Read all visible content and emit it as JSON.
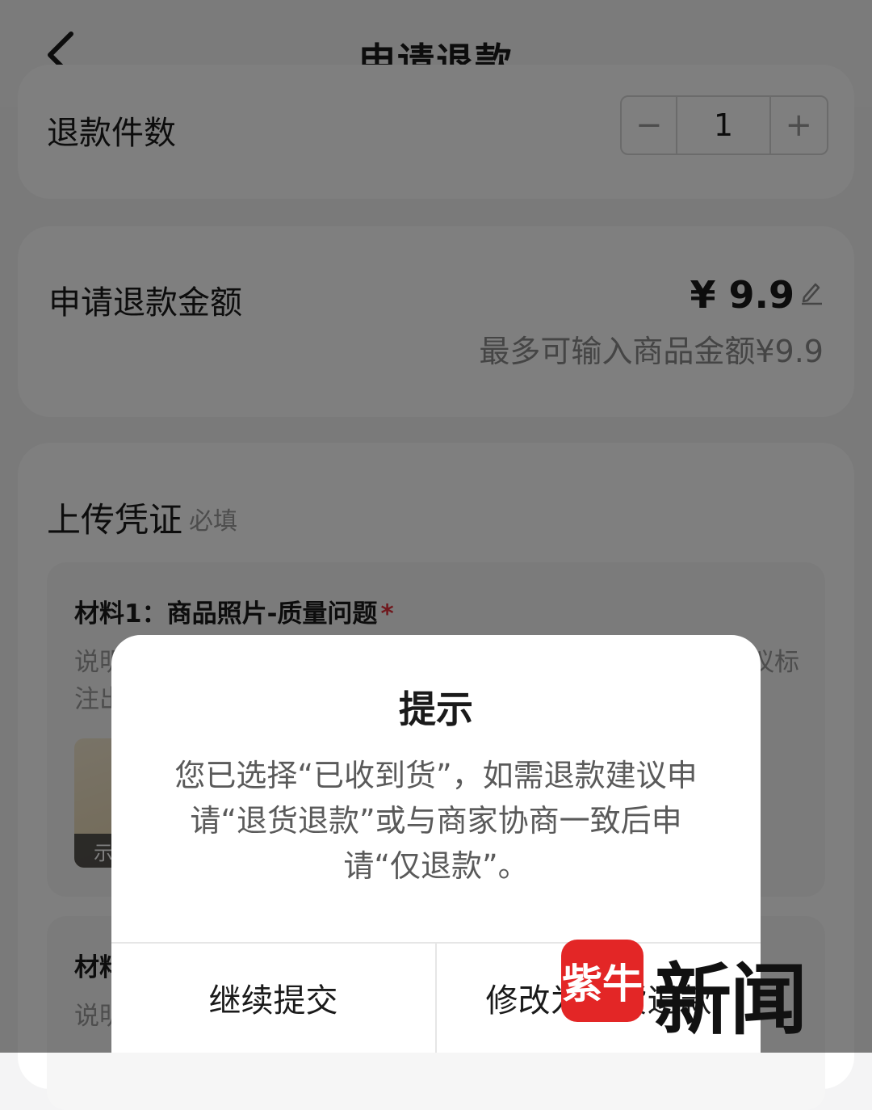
{
  "header": {
    "title": "申请退款"
  },
  "quantity": {
    "label": "退款件数",
    "minus": "−",
    "value": "1",
    "plus": "+"
  },
  "amount": {
    "label": "申请退款金额",
    "value": "¥ 9.9",
    "hint": "最多可输入商品金额¥9.9"
  },
  "upload": {
    "title": "上传凭证",
    "required": "必填",
    "material1": {
      "title": "材料1：商品照片-质量问题",
      "star": "*",
      "desc_a": "说明",
      "desc_b": "注出",
      "desc_tail": "议标",
      "image_tag": "示"
    },
    "material2": {
      "title": "材料",
      "desc": "说明"
    }
  },
  "dialog": {
    "title": "提示",
    "message": "您已选择“已收到货”，如需退款建议申请“退货退款”或与商家协商一致后申请“仅退款”。",
    "continue_label": "继续提交",
    "modify_label": "修改为退货退款"
  },
  "watermark": {
    "logo": "紫牛",
    "text": "新闻"
  }
}
